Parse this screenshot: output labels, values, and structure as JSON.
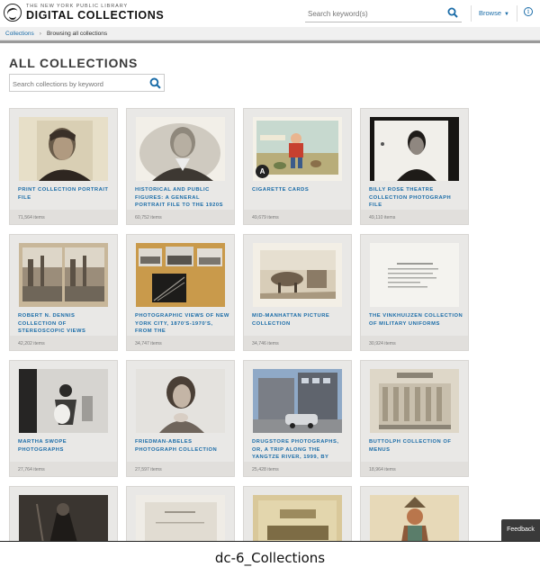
{
  "header": {
    "logo_small": "THE NEW YORK PUBLIC LIBRARY",
    "logo_big": "DIGITAL COLLECTIONS",
    "search_placeholder": "Search keyword(s)",
    "browse_label": "Browse",
    "info_label": "i"
  },
  "breadcrumb": {
    "root": "Collections",
    "separator": "›",
    "current": "Browsing all collections"
  },
  "page": {
    "title": "ALL COLLECTIONS",
    "search_placeholder": "Search collections by keyword"
  },
  "cards": [
    {
      "title": "Print collection portrait file",
      "count": "71,564 items"
    },
    {
      "title": "Historical and public figures: a general portrait file to the 1920s",
      "count": "60,752 items"
    },
    {
      "title": "Cigarette cards",
      "count": "49,679 items",
      "badge": "A"
    },
    {
      "title": "Billy Rose Theatre Collection photograph file",
      "count": "49,110 items"
    },
    {
      "title": "Robert N. Dennis collection of stereoscopic views",
      "count": "42,202 items"
    },
    {
      "title": "Photographic views of New York City, 1870's-1970's, from the",
      "count": "34,747 items"
    },
    {
      "title": "Mid-Manhattan Picture Collection",
      "count": "34,746 items"
    },
    {
      "title": "The Vinkhuijzen collection of military uniforms",
      "count": "30,924 items"
    },
    {
      "title": "Martha Swope photographs",
      "count": "27,764 items"
    },
    {
      "title": "Friedman-Abeles photograph collection",
      "count": "27,597 items"
    },
    {
      "title": "Drugstore photographs, or, a trip along the Yangtze River, 1999, by",
      "count": "25,428 items"
    },
    {
      "title": "Buttolph collection of menus",
      "count": "18,964 items"
    },
    {
      "title": "",
      "count": ""
    },
    {
      "title": "",
      "count": ""
    },
    {
      "title": "",
      "count": ""
    },
    {
      "title": "",
      "count": ""
    }
  ],
  "feedback_label": "Feedback",
  "caption": "dc-6_Collections",
  "colors": {
    "link": "#1a6ca8",
    "card_bg": "#e9e8e6",
    "feedback_bg": "#3a3a3a"
  }
}
